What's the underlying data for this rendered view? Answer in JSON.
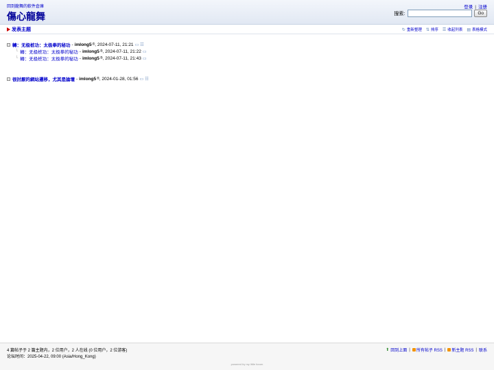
{
  "header": {
    "home_link": "回到龍舞的軟件倉庫",
    "site_title": "傷心龍舞",
    "login": "登录",
    "register": "注册",
    "search_label": "搜索:",
    "search_value": "",
    "search_button": "Go"
  },
  "toolbar": {
    "new_topic": "发表主题",
    "tools": [
      "重新整理",
      "排序",
      "收起列表",
      "表格模式"
    ]
  },
  "threads": [
    {
      "subject": "轉：无极桩功：太极拳的秘功",
      "author": "imlong5",
      "reg": "®",
      "date": "2024-07-11, 21:21",
      "replies": [
        {
          "subject": "轉：无极桩功：太极拳的秘功",
          "author": "imlong5",
          "reg": "®",
          "date": "2024-07-11, 21:22"
        },
        {
          "subject": "轉：无极桩功：太极拳的秘功",
          "author": "imlong5",
          "reg": "®",
          "date": "2024-07-11, 21:43"
        }
      ]
    },
    {
      "subject": "很討厭的網站遷移，尤其是論壇",
      "author": "imlong5",
      "reg": "®",
      "date": "2024-01-28, 01:56",
      "replies": []
    }
  ],
  "footer": {
    "stats": "4 篇帖子于 2 篇主题内，2 位用户，2 人在线 (0 位用户，2 位游客)",
    "time": "论坛时间：2025-04-22, 09:00 (Asia/Hong_Kong)",
    "back_to_top": "回到上面",
    "rss_all": "所有帖子 RSS",
    "rss_topics": "新主题 RSS",
    "contact": "联系",
    "powered": "powered by my little forum"
  },
  "colors": {
    "link": "#0000cc",
    "title": "#000099",
    "header_bg": "#e1e8f3",
    "rss": "#f29300"
  },
  "icons": [
    "refresh-icon",
    "sort-icon",
    "collapse-icon",
    "table-icon",
    "post-icon",
    "tree-icon",
    "rss-icon",
    "arrow-up-icon"
  ]
}
